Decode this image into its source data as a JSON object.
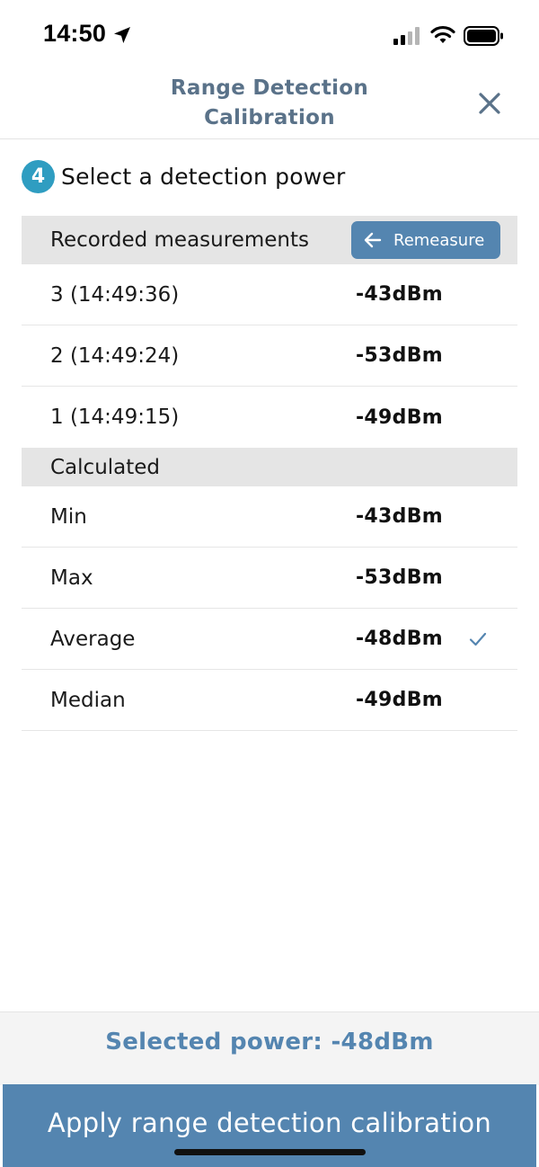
{
  "status_bar": {
    "time": "14:50"
  },
  "header": {
    "title_line1": "Range Detection",
    "title_line2": "Calibration"
  },
  "step": {
    "number": "4",
    "title": "Select a detection power"
  },
  "recorded": {
    "heading": "Recorded measurements",
    "remeasure_label": "Remeasure",
    "rows": [
      {
        "label": "3 (14:49:36)",
        "value": "-43dBm"
      },
      {
        "label": "2 (14:49:24)",
        "value": "-53dBm"
      },
      {
        "label": "1 (14:49:15)",
        "value": "-49dBm"
      }
    ]
  },
  "calculated": {
    "heading": "Calculated",
    "rows": [
      {
        "label": "Min",
        "value": "-43dBm",
        "selected": false
      },
      {
        "label": "Max",
        "value": "-53dBm",
        "selected": false
      },
      {
        "label": "Average",
        "value": "-48dBm",
        "selected": true
      },
      {
        "label": "Median",
        "value": "-49dBm",
        "selected": false
      }
    ]
  },
  "footer": {
    "selected_power": "Selected power: -48dBm",
    "apply_label": "Apply range detection calibration"
  },
  "colors": {
    "accent": "#5485b0",
    "title": "#5a7289",
    "badge": "#2f9dc1",
    "section_bg": "#e5e5e5"
  }
}
